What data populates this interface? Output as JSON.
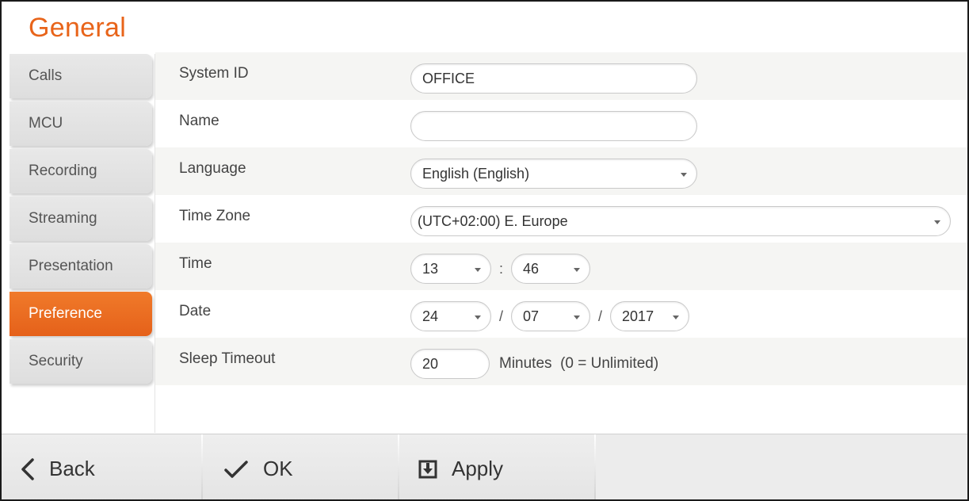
{
  "page": {
    "title": "General"
  },
  "sidebar": {
    "items": [
      {
        "label": "Calls",
        "active": false
      },
      {
        "label": "MCU",
        "active": false
      },
      {
        "label": "Recording",
        "active": false
      },
      {
        "label": "Streaming",
        "active": false
      },
      {
        "label": "Presentation",
        "active": false
      },
      {
        "label": "Preference",
        "active": true
      },
      {
        "label": "Security",
        "active": false
      }
    ]
  },
  "form": {
    "system_id": {
      "label": "System ID",
      "value": "OFFICE"
    },
    "name": {
      "label": "Name",
      "value": ""
    },
    "language": {
      "label": "Language",
      "value": "English (English)"
    },
    "time_zone": {
      "label": "Time Zone",
      "value": "(UTC+02:00) E. Europe"
    },
    "time": {
      "label": "Time",
      "hour": "13",
      "separator": ":",
      "minute": "46"
    },
    "date": {
      "label": "Date",
      "day": "24",
      "month": "07",
      "year": "2017",
      "separator": "/"
    },
    "sleep_timeout": {
      "label": "Sleep Timeout",
      "value": "20",
      "suffix": "Minutes  (0 = Unlimited)"
    }
  },
  "toolbar": {
    "back_label": "Back",
    "ok_label": "OK",
    "apply_label": "Apply"
  },
  "colors": {
    "accent": "#e8641a",
    "sidebar_bg": "#e2e2e2",
    "row_shade": "#f5f5f3"
  },
  "icons": {
    "back": "chevron-left-icon",
    "ok": "checkmark-icon",
    "apply": "apply-save-icon"
  }
}
